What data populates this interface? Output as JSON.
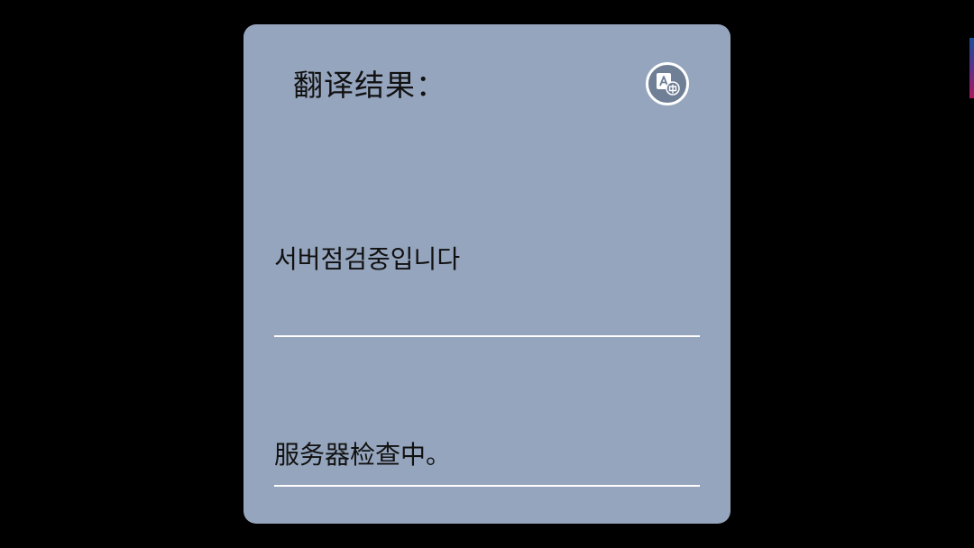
{
  "panel": {
    "title": "翻译结果：",
    "translate_icon": "translate-icon",
    "background_color": "#95a5bd"
  },
  "results": {
    "source_text": "서버점검중입니다",
    "translated_text": "服务器检查中。"
  },
  "colors": {
    "backdrop": "#000000",
    "divider": "#ffffff",
    "text": "#111111"
  }
}
